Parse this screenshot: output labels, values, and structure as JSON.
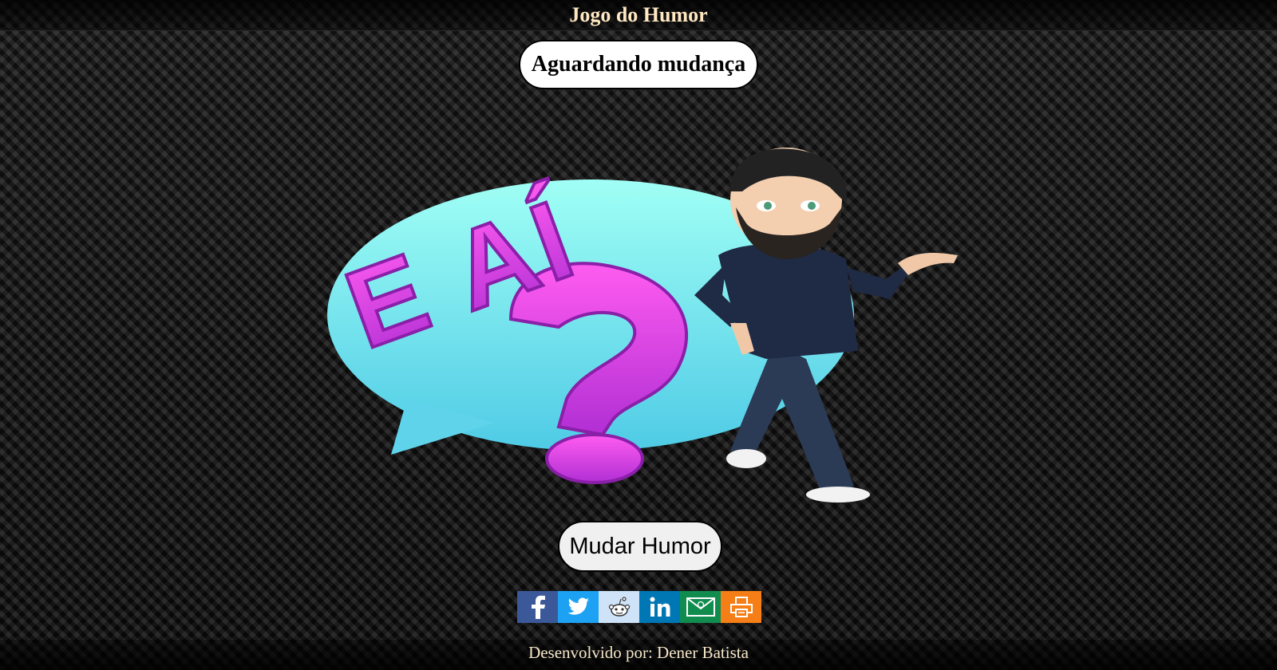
{
  "header": {
    "title": "Jogo do Humor"
  },
  "status": {
    "text": "Aguardando mudança"
  },
  "artwork": {
    "bubble_text": "E AÍ",
    "mark": "?"
  },
  "actions": {
    "change_mood_label": "Mudar Humor"
  },
  "share": {
    "buttons": [
      {
        "name": "facebook",
        "icon": "facebook-icon",
        "color": "#3b5998"
      },
      {
        "name": "twitter",
        "icon": "twitter-icon",
        "color": "#1da1f2"
      },
      {
        "name": "reddit",
        "icon": "reddit-icon",
        "color": "#cee3f8"
      },
      {
        "name": "linkedin",
        "icon": "linkedin-icon",
        "color": "#0077b5"
      },
      {
        "name": "email",
        "icon": "email-icon",
        "color": "#118c4f"
      },
      {
        "name": "print",
        "icon": "print-icon",
        "color": "#f57e17"
      }
    ]
  },
  "footer": {
    "credit": "Desenvolvido por: Dener Batista"
  },
  "colors": {
    "title": "#ffe8c2",
    "bubble": "#7ee8f0",
    "letters": "#e040f0"
  }
}
